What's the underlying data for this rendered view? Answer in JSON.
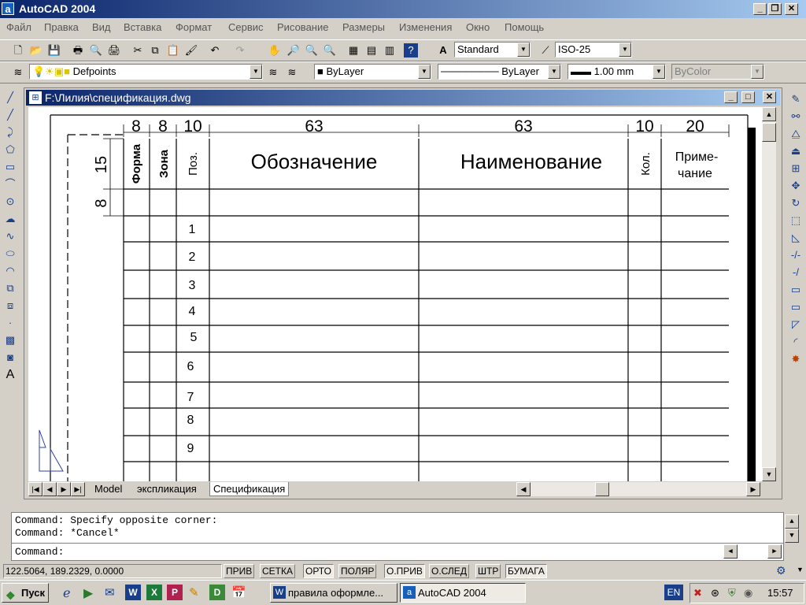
{
  "window": {
    "title": "AutoCAD 2004",
    "app_icon": "a"
  },
  "menu": [
    "Файл",
    "Правка",
    "Вид",
    "Вставка",
    "Формат",
    "Сервис",
    "Рисование",
    "Размеры",
    "Изменения",
    "Окно",
    "Помощь"
  ],
  "toolbar": {
    "text_style": "Standard",
    "dim_style": "ISO-25",
    "layer": "Defpoints",
    "color": "ByLayer",
    "linetype": "ByLayer",
    "lineweight": "1.00 mm",
    "plot_style": "ByColor"
  },
  "drawing": {
    "title": "F:\\Лилия\\спецификация.dwg",
    "col_widths": [
      "8",
      "8",
      "10",
      "63",
      "63",
      "10",
      "20"
    ],
    "row_dims": [
      "15",
      "8"
    ],
    "headers": [
      "Форма",
      "Зона",
      "Поз.",
      "Обозначение",
      "Наименование",
      "Кол.",
      "Приме-",
      "чание"
    ],
    "positions": [
      "1",
      "2",
      "3",
      "4",
      "5",
      "6",
      "7",
      "8",
      "9"
    ]
  },
  "tabs": [
    "Model",
    "экспликация",
    "Спецификация"
  ],
  "command": {
    "lines": [
      "Command: Specify opposite corner:",
      "Command: *Cancel*"
    ],
    "prompt": "Command:"
  },
  "status": {
    "coords": "122.5064, 189.2329, 0.0000",
    "modes": [
      "ПРИВ",
      "СЕТКА",
      "ОРТО",
      "ПОЛЯР",
      "О.ПРИВ",
      "О.СЛЕД",
      "ШТР",
      "БУМАГА"
    ]
  },
  "taskbar": {
    "start": "Пуск",
    "tasks": [
      "правила оформле...",
      "AutoCAD 2004"
    ],
    "lang": "EN",
    "time": "15:57"
  },
  "colors": {
    "title_start": "#0a246a",
    "title_end": "#a6caf0",
    "ui_gray": "#d4d0c8"
  }
}
